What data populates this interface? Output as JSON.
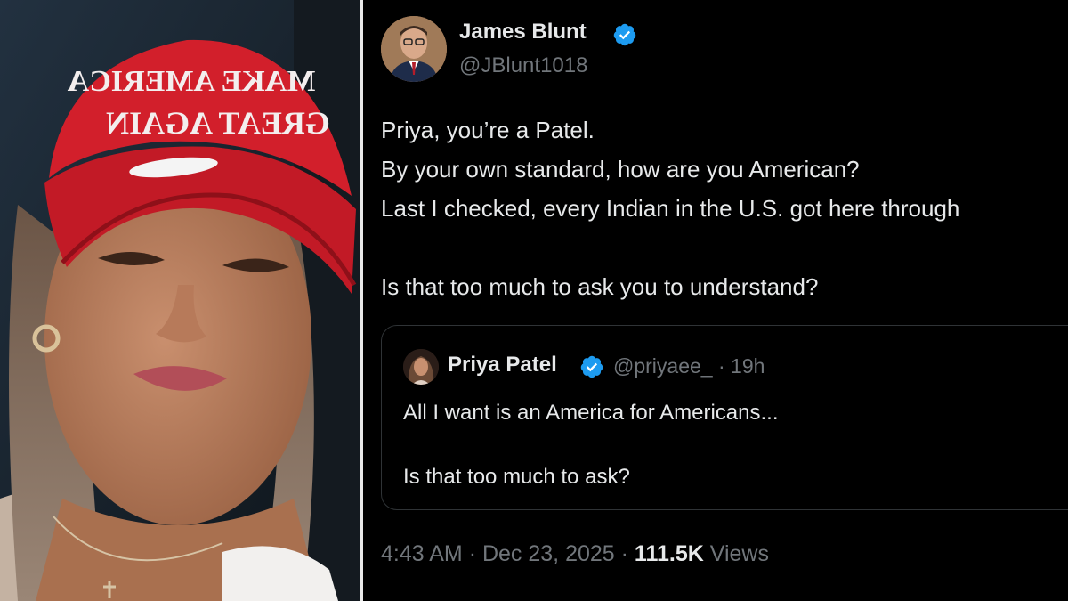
{
  "photo": {
    "hat_text_line1": "MAKE AMERICA",
    "hat_text_line2": "GREAT AGAIN",
    "colors": {
      "hat": "#d21f2b",
      "background": "#1b2530"
    }
  },
  "tweet": {
    "author": {
      "name": "James Blunt",
      "handle": "@JBlunt1018",
      "verified": true
    },
    "body_lines": [
      "Priya, you’re a Patel.",
      "By your own standard, how are you American?",
      "Last I checked, every Indian in the U.S. got here through",
      "",
      "Is that too much to ask you to understand?"
    ],
    "quoted": {
      "name": "Priya Patel",
      "handle": "@priyaee_",
      "separator": "·",
      "time": "19h",
      "verified": true,
      "lines": [
        "All I want is an America for Americans...",
        "",
        "Is that too much to ask?"
      ]
    },
    "footer": {
      "time": "4:43 AM",
      "sep1": "·",
      "date": "Dec 23, 2025",
      "sep2": "·",
      "views_count": "111.5K",
      "views_label": "Views"
    }
  },
  "colors": {
    "background": "#000000",
    "text": "#e7e9ea",
    "muted": "#71767b",
    "verified": "#1d9bf0",
    "border": "#2f3336"
  }
}
